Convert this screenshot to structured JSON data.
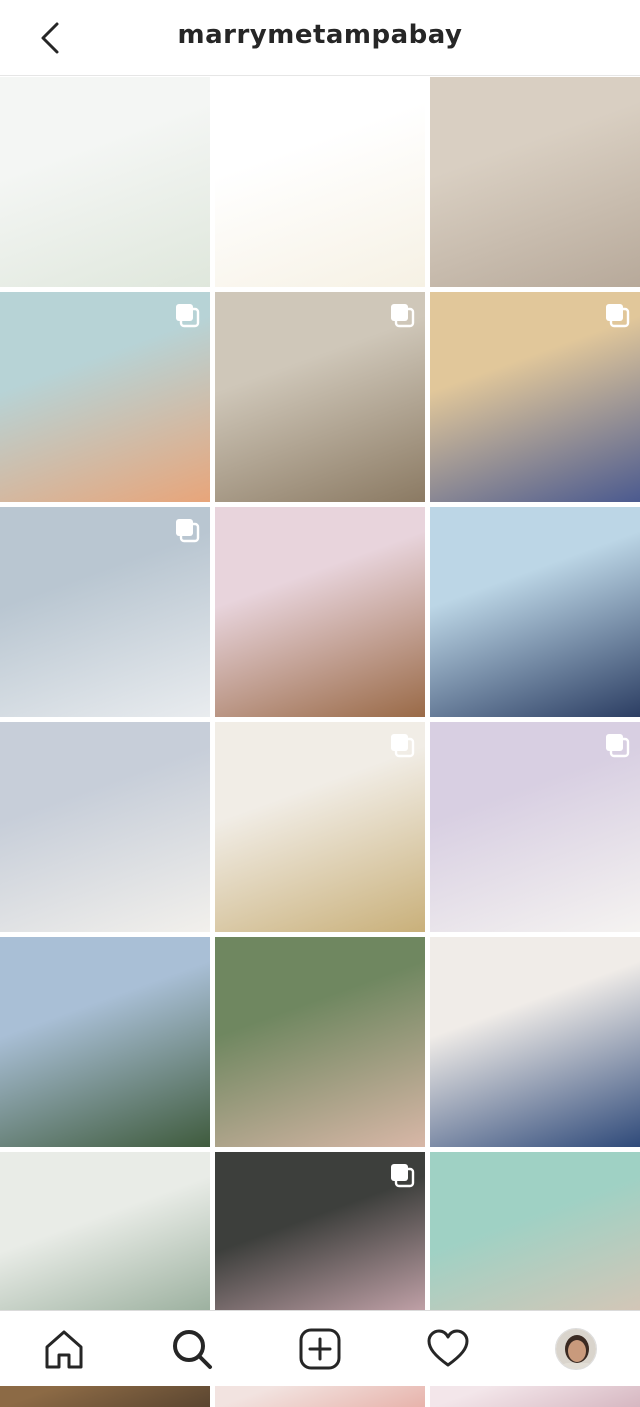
{
  "header": {
    "title": "marrymetampabay",
    "back_icon": "chevron-left-icon"
  },
  "grid": {
    "posts": [
      {
        "name": "post-reception-tables",
        "colors": [
          "#f4f6f4",
          "#dfe7dc"
        ],
        "carousel": false
      },
      {
        "name": "post-cake-cart-illustration",
        "colors": [
          "#ffffff",
          "#f6f1e4"
        ],
        "carousel": false
      },
      {
        "name": "post-couple-indoor",
        "colors": [
          "#d9cfc2",
          "#b7a99a"
        ],
        "carousel": false
      },
      {
        "name": "post-drinks-table",
        "colors": [
          "#b7d3d6",
          "#e8a57a"
        ],
        "carousel": true
      },
      {
        "name": "post-gazebo-kiss",
        "colors": [
          "#cfc7b9",
          "#8b7a63"
        ],
        "carousel": true
      },
      {
        "name": "post-blue-doors",
        "colors": [
          "#e1c79a",
          "#4b5a8f"
        ],
        "carousel": true
      },
      {
        "name": "post-beach-arch",
        "colors": [
          "#b9c6d1",
          "#e9ecef"
        ],
        "carousel": true
      },
      {
        "name": "post-place-card",
        "colors": [
          "#e8d4dc",
          "#9a6a47"
        ],
        "carousel": false
      },
      {
        "name": "post-couple-smoke",
        "colors": [
          "#bcd6e6",
          "#2c3e63"
        ],
        "carousel": false
      },
      {
        "name": "post-bouquet-bridesmaid",
        "colors": [
          "#c7ced9",
          "#f2f0ec"
        ],
        "carousel": false
      },
      {
        "name": "post-menu-place-setting",
        "colors": [
          "#f1ede6",
          "#c9b07a"
        ],
        "carousel": true
      },
      {
        "name": "post-pastel-cake",
        "colors": [
          "#d8cfe2",
          "#f5f3f1"
        ],
        "carousel": true
      },
      {
        "name": "post-palm-ceremony",
        "colors": [
          "#a9bfd6",
          "#3f5b3d"
        ],
        "carousel": false
      },
      {
        "name": "post-bridesmaids-group",
        "colors": [
          "#6f8760",
          "#d8b7a7"
        ],
        "carousel": false
      },
      {
        "name": "post-vows-officiant",
        "colors": [
          "#f0ece8",
          "#2f4a7a"
        ],
        "carousel": false
      },
      {
        "name": "post-protea-bouquet",
        "colors": [
          "#e9ece7",
          "#7f9a84"
        ],
        "carousel": false
      },
      {
        "name": "post-pink-floral-cake",
        "colors": [
          "#3d3f3c",
          "#f1c5cf"
        ],
        "carousel": true
      },
      {
        "name": "post-couple-dog",
        "colors": [
          "#9fd1c4",
          "#e7c2b2"
        ],
        "carousel": false
      },
      {
        "name": "post-partial-1",
        "colors": [
          "#8c6a45",
          "#5a4530"
        ],
        "carousel": false
      },
      {
        "name": "post-partial-2",
        "colors": [
          "#f2e3e0",
          "#e7b3ab"
        ],
        "carousel": false
      },
      {
        "name": "post-partial-3",
        "colors": [
          "#f3e6ea",
          "#d6b7c1"
        ],
        "carousel": false
      }
    ]
  },
  "tabbar": {
    "items": [
      {
        "name": "tab-home",
        "icon": "home-icon"
      },
      {
        "name": "tab-search",
        "icon": "search-icon",
        "active": true
      },
      {
        "name": "tab-new-post",
        "icon": "plus-square-icon"
      },
      {
        "name": "tab-activity",
        "icon": "heart-icon"
      },
      {
        "name": "tab-profile",
        "icon": "avatar"
      }
    ]
  },
  "colors": {
    "text": "#262626",
    "border": "#dbdbdb",
    "background": "#ffffff"
  }
}
